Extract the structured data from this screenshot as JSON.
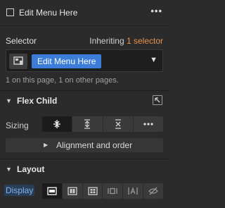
{
  "header": {
    "title": "Edit Menu Here",
    "more_label": "•••"
  },
  "selector": {
    "label": "Selector",
    "inheriting_text": "Inheriting",
    "inheriting_count": "1 selector",
    "chip_label": "Edit Menu Here",
    "info": "1 on this page, 1 on other pages.",
    "accent_color": "#e8924a",
    "chip_color": "#3b7dd8"
  },
  "flex_child": {
    "title": "Flex Child",
    "sizing_label": "Sizing",
    "sizing_options": [
      {
        "icon": "shrink-icon",
        "active": true
      },
      {
        "icon": "grow-icon",
        "active": false
      },
      {
        "icon": "none-icon",
        "active": false
      },
      {
        "icon": "more-icon",
        "active": false
      }
    ],
    "align_label": "Alignment and order"
  },
  "layout": {
    "title": "Layout",
    "display_label": "Display",
    "display_options": [
      {
        "icon": "block-icon",
        "active": true
      },
      {
        "icon": "flex-icon",
        "active": false
      },
      {
        "icon": "grid-icon",
        "active": false
      },
      {
        "icon": "inline-block-icon",
        "active": false
      },
      {
        "icon": "inline-icon",
        "active": false
      },
      {
        "icon": "none-hidden-icon",
        "active": false
      }
    ]
  }
}
